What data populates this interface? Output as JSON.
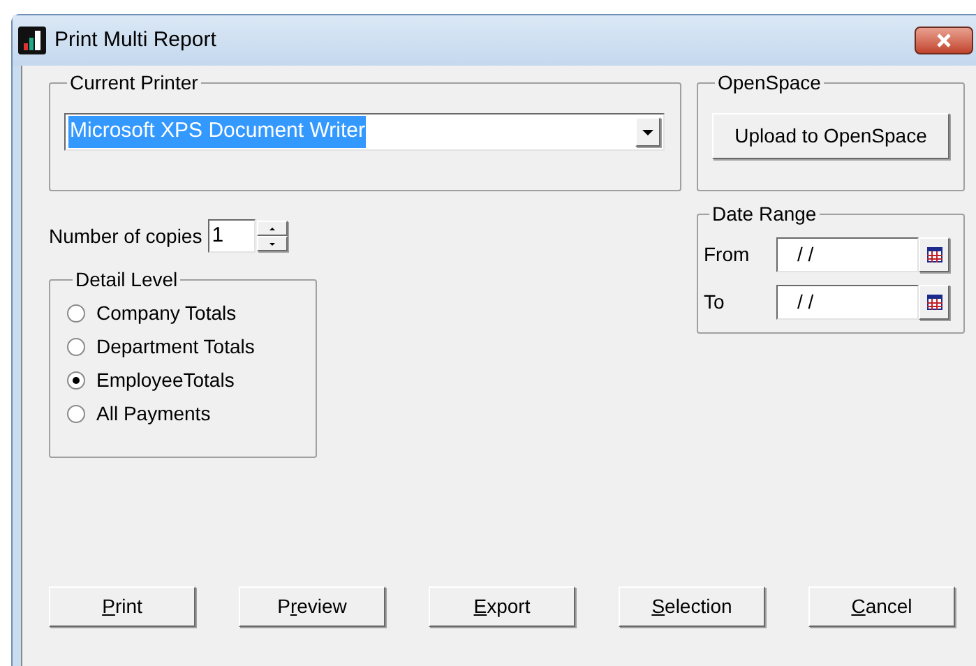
{
  "window": {
    "title": "Print Multi Report"
  },
  "current_printer": {
    "label": "Current Printer",
    "value": "Microsoft XPS Document Writer",
    "selected": true
  },
  "copies": {
    "label": "Number of copies",
    "value": "1"
  },
  "detail_level": {
    "label": "Detail Level",
    "options": [
      {
        "label": "Company Totals",
        "selected": false
      },
      {
        "label": "Department Totals",
        "selected": false
      },
      {
        "label": "EmployeeTotals",
        "selected": true
      },
      {
        "label": "All Payments",
        "selected": false
      }
    ]
  },
  "openspace": {
    "label": "OpenSpace",
    "button": "Upload to OpenSpace"
  },
  "date_range": {
    "label": "Date Range",
    "fields": [
      {
        "label": "From",
        "value": "/ /"
      },
      {
        "label": "To",
        "value": "/ /"
      }
    ]
  },
  "buttons": [
    {
      "access_key": "P",
      "after": "rint"
    },
    {
      "before": "P",
      "access_key": "r",
      "after": "eview"
    },
    {
      "access_key": "E",
      "after": "xport"
    },
    {
      "access_key": "S",
      "after": "election"
    },
    {
      "access_key": "C",
      "after": "ancel"
    }
  ]
}
